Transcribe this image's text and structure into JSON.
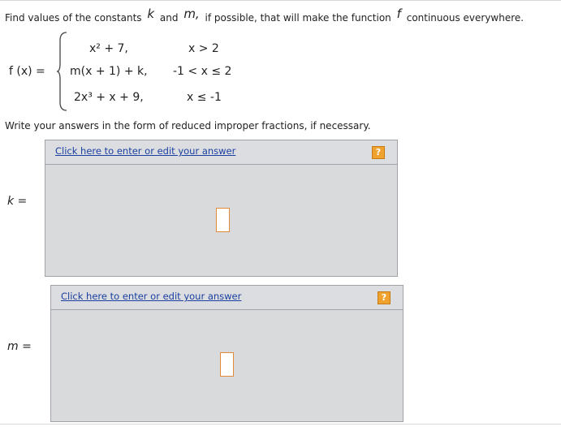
{
  "question": {
    "prefix": "Find values of the constants",
    "var_k": "k",
    "and": "and",
    "var_m": "m,",
    "middle": "if possible, that will make the function",
    "var_f": "f",
    "suffix": "continuous everywhere."
  },
  "function": {
    "label": "f (x) =",
    "pieces": [
      {
        "expression": "x² + 7,",
        "condition": "x > 2"
      },
      {
        "expression": "m(x + 1) + k,",
        "condition": "-1 < x ≤ 2"
      },
      {
        "expression": "2x³ + x + 9,",
        "condition": "x ≤ -1"
      }
    ]
  },
  "instructions": "Write your answers in the form of reduced improper fractions, if necessary.",
  "answers": [
    {
      "label": "k =",
      "link_text": "Click here to enter or edit your answer",
      "help_icon": "?"
    },
    {
      "label": "m =",
      "link_text": "Click here to enter or edit your answer",
      "help_icon": "?"
    }
  ],
  "colors": {
    "link": "#1a3fa0",
    "help_icon": "#f0a22e",
    "answer_slot_border": "#e08a3a",
    "answer_box_bg": "#d9dadc"
  }
}
